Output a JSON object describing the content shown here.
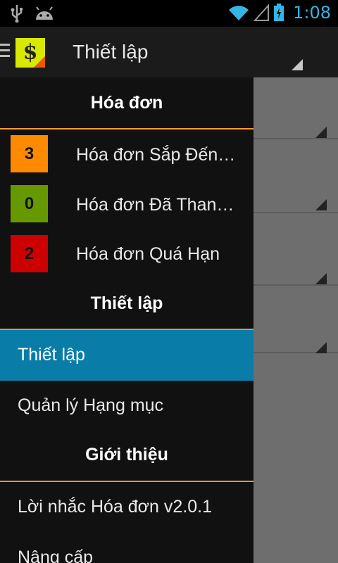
{
  "status_bar": {
    "time": "1:08",
    "icons": [
      "usb-icon",
      "android-icon",
      "wifi-icon",
      "signal-icon",
      "battery-charging-icon"
    ],
    "clock_color": "#33b5e5"
  },
  "action_bar": {
    "title": "Thiết lập",
    "logo_symbol": "$"
  },
  "drawer": {
    "sections": [
      {
        "title": "Hóa đơn"
      },
      {
        "title": "Thiết lập"
      },
      {
        "title": "Giới thiệu"
      }
    ],
    "bills": [
      {
        "count": "3",
        "label": "Hóa đơn Sắp Đến Hạn",
        "color": "#ff8a00"
      },
      {
        "count": "0",
        "label": "Hóa đơn Đã Thanh Toán",
        "color": "#669900"
      },
      {
        "count": "2",
        "label": "Hóa đơn Quá Hạn",
        "color": "#cc0000"
      }
    ],
    "settings_items": [
      {
        "label": "Thiết lập",
        "selected": true
      },
      {
        "label": "Quản lý Hạng mục",
        "selected": false
      }
    ],
    "about_items": [
      {
        "label": "Lời nhắc Hóa đơn v2.0.1"
      },
      {
        "label": "Nâng cấp"
      }
    ],
    "accent": "#ff9a2e",
    "selected_color": "#0a7ca8"
  }
}
